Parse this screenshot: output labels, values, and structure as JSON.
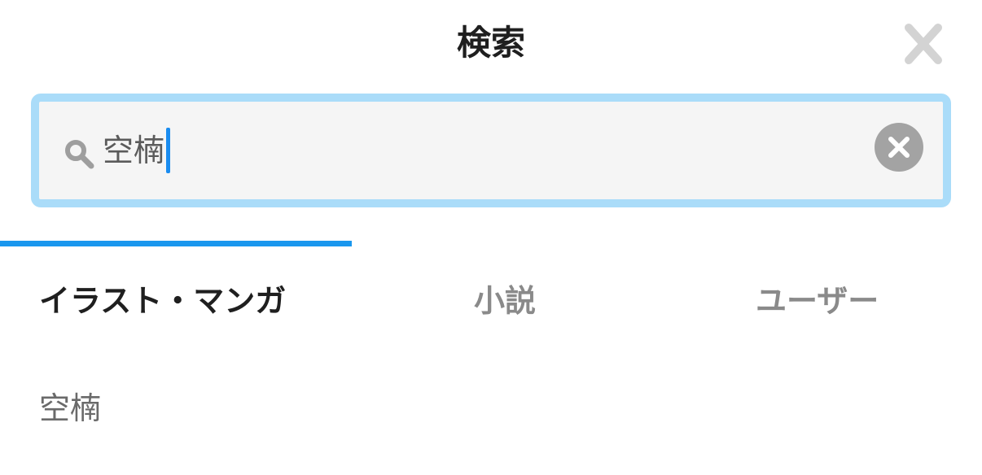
{
  "header": {
    "title": "検索"
  },
  "search": {
    "value": "空楠"
  },
  "tabs": [
    {
      "label": "イラスト・マンガ",
      "active": true
    },
    {
      "label": "小説",
      "active": false
    },
    {
      "label": "ユーザー",
      "active": false
    }
  ],
  "suggestions": [
    {
      "label": "空楠"
    }
  ],
  "colors": {
    "accent": "#1a97ee",
    "search_border": "#aadcf9",
    "field_bg": "#f5f5f5",
    "icon_gray": "#a3a3a3"
  },
  "icons": {
    "close": "close-icon",
    "search": "search-icon",
    "clear": "clear-circle-icon"
  }
}
